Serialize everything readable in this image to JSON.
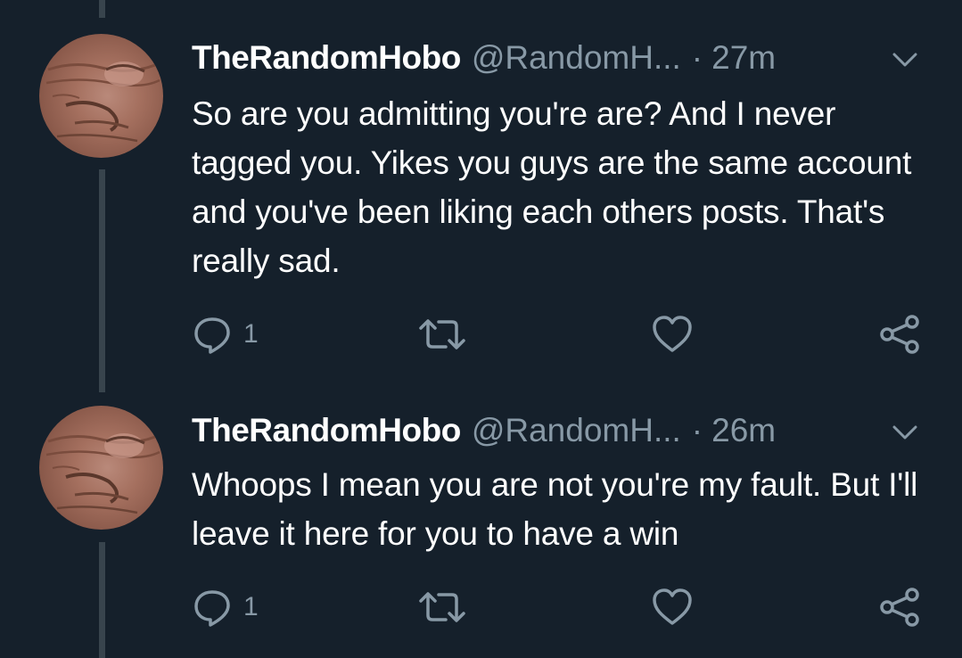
{
  "colors": {
    "background": "#15202b",
    "thread_line": "#38444d",
    "text": "#ffffff",
    "secondary": "#8899a6"
  },
  "tweets": [
    {
      "name": "TheRandomHobo",
      "handle": "@RandomH...",
      "separator": "·",
      "time": "27m",
      "text": "So are you admitting you're are? And I never tagged you. Yikes you guys are the same account and you've been liking each others posts. That's really sad.",
      "reply_count": "1",
      "icons": [
        "reply-icon",
        "retweet-icon",
        "like-icon",
        "share-icon",
        "chevron-down-icon"
      ]
    },
    {
      "name": "TheRandomHobo",
      "handle": "@RandomH...",
      "separator": "·",
      "time": "26m",
      "text": "Whoops I mean you are not you're my fault. But I'll leave it here for you to have a win",
      "reply_count": "1",
      "icons": [
        "reply-icon",
        "retweet-icon",
        "like-icon",
        "share-icon",
        "chevron-down-icon"
      ]
    }
  ]
}
